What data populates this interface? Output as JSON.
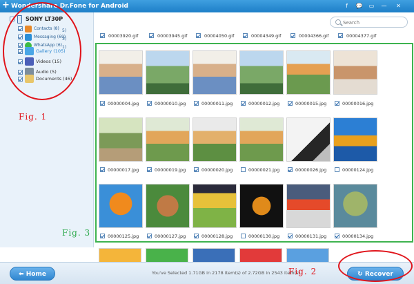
{
  "titlebar": {
    "logo": "+",
    "title": "Wondershare Dr.Fone for Android",
    "controls": [
      "f",
      "💬",
      "▭",
      "—",
      "✕"
    ]
  },
  "sidebar": {
    "device": "SONY LT30P",
    "categories": [
      {
        "label": "Contacts (8)",
        "color": "#e8892a"
      },
      {
        "label": "Messaging (69)",
        "color": "#2d8fd6"
      },
      {
        "label": "WhatsApp (6)",
        "color": "#3dbb45"
      },
      {
        "label": "Gallery (105)",
        "color": "#4aa6e6"
      },
      {
        "label": "Videos (15)",
        "color": "#4b5fb8"
      },
      {
        "label": "Audio (5)",
        "color": "#7b8d9c"
      },
      {
        "label": "Documents (46)",
        "color": "#e8c66a"
      }
    ],
    "overlaps": [
      "5)",
      "3)",
      "1)"
    ]
  },
  "search": {
    "placeholder": "Search"
  },
  "top_row": [
    "00003920.gif",
    "00003945.gif",
    "00004050.gif",
    "00004349.gif",
    "00004366.gif",
    "00004377.gif"
  ],
  "grid_rows": [
    [
      {
        "name": "00000004.jpg",
        "checked": true
      },
      {
        "name": "00000010.jpg",
        "checked": true
      },
      {
        "name": "00000011.jpg",
        "checked": true
      },
      {
        "name": "00000012.jpg",
        "checked": true
      },
      {
        "name": "00000015.jpg",
        "checked": true
      },
      {
        "name": "00000016.jpg",
        "checked": true
      }
    ],
    [
      {
        "name": "00000017.jpg",
        "checked": true
      },
      {
        "name": "00000019.jpg",
        "checked": true
      },
      {
        "name": "00000020.jpg",
        "checked": true
      },
      {
        "name": "00000021.jpg",
        "checked": false
      },
      {
        "name": "00000026.jpg",
        "checked": true
      },
      {
        "name": "00000124.jpg",
        "checked": false
      }
    ],
    [
      {
        "name": "00000125.jpg",
        "checked": true
      },
      {
        "name": "00000127.jpg",
        "checked": true
      },
      {
        "name": "00000128.jpg",
        "checked": true
      },
      {
        "name": "00000130.jpg",
        "checked": false
      },
      {
        "name": "00000131.jpg",
        "checked": true
      },
      {
        "name": "00000134.jpg",
        "checked": true
      }
    ]
  ],
  "annotations": {
    "fig1": "Fig. 1",
    "fig2": "Fig. 2",
    "fig3": "Fig. 3"
  },
  "footer": {
    "home_label": "Home",
    "recover_label": "Recover",
    "status": "You've Selected 1.71GB in 2178 item(s) of 2.72GB in 2543 item(s)"
  },
  "colors": {
    "accent": "#2f86d0",
    "annotation_red": "#e0141b",
    "annotation_green": "#2aa84a"
  }
}
